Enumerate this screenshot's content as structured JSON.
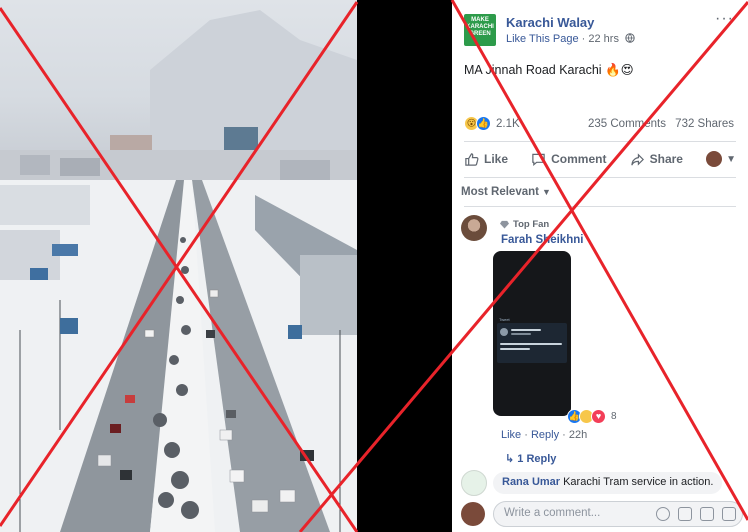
{
  "post": {
    "page_name": "Karachi Walay",
    "logo_text": "MAKE KARACHI GREEN",
    "like_page": "Like This Page",
    "time": "22 hrs",
    "text": "MA Jinnah Road Karachi 🔥😍",
    "reaction_count": "2.1K",
    "comments_count": "235 Comments",
    "shares_count": "732 Shares"
  },
  "actions": {
    "like": "Like",
    "comment": "Comment",
    "share": "Share"
  },
  "comments": {
    "sort_label": "Most Relevant",
    "first": {
      "badge": "Top Fan",
      "author": "Farah Sheikhni",
      "screenshot_text": "Tweet",
      "reaction_count": "8",
      "like": "Like",
      "reply": "Reply",
      "time": "22h",
      "replies_link": "1 Reply"
    },
    "second": {
      "author": "Rana Umar",
      "text": "Karachi Tram service in action."
    },
    "composer_placeholder": "Write a comment..."
  },
  "colors": {
    "link_blue": "#385898",
    "overlay_red": "#e8232a",
    "logo_green": "#2d9b4a"
  }
}
